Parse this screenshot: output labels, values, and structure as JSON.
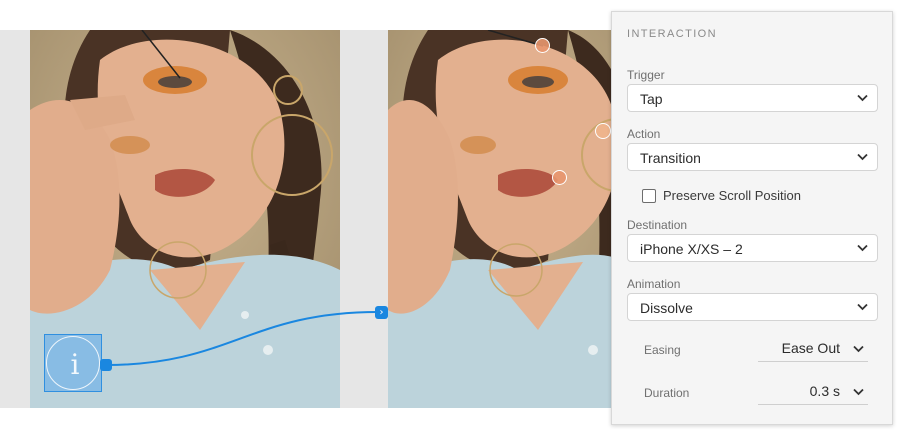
{
  "panel": {
    "title": "INTERACTION",
    "trigger": {
      "label": "Trigger",
      "value": "Tap"
    },
    "action": {
      "label": "Action",
      "value": "Transition"
    },
    "preserve_scroll": {
      "label": "Preserve Scroll Position",
      "checked": false
    },
    "destination": {
      "label": "Destination",
      "value": "iPhone X/XS – 2"
    },
    "animation": {
      "label": "Animation",
      "value": "Dissolve"
    },
    "easing": {
      "label": "Easing",
      "value": "Ease Out"
    },
    "duration": {
      "label": "Duration",
      "value": "0.3 s"
    }
  },
  "icons": {
    "hotspot": "info-icon",
    "connector_arrow": "arrow-right-icon",
    "dropdown": "chevron-down-icon"
  },
  "colors": {
    "wire": "#1a87e0",
    "hotspot_fill": "#5caaeb",
    "panel_bg": "#f5f5f5",
    "canvas_bg": "#e6e6e6",
    "marker": "#e7966e"
  }
}
